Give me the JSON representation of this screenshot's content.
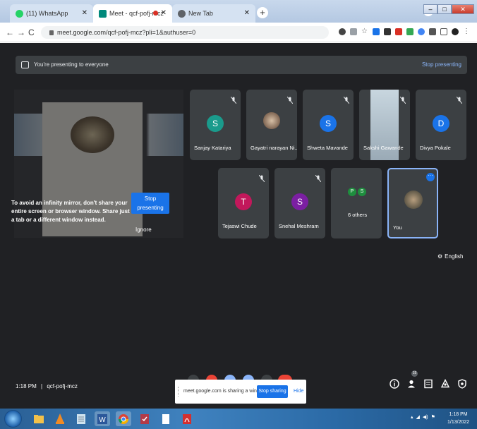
{
  "browser": {
    "tabs": [
      {
        "label": "(11) WhatsApp",
        "icon": "whatsapp-icon",
        "color": "#25d366"
      },
      {
        "label": "Meet - qcf-pofj-mcz",
        "icon": "meet-icon",
        "color": "#00897b"
      },
      {
        "label": "New Tab",
        "icon": "chrome-icon",
        "color": "#5f6368"
      }
    ],
    "url": "meet.google.com/qcf-pofj-mcz?pli=1&authuser=0"
  },
  "meet": {
    "banner": {
      "text": "You're presenting to everyone",
      "action": "Stop presenting"
    },
    "preview": {
      "message": "To avoid an infinity mirror, don't share your entire screen or browser window. Share just a tab or a different window instead.",
      "stop_button": "Stop presenting",
      "ignore_button": "Ignore"
    },
    "participants": [
      {
        "name": "Sanjay Katariya",
        "initial": "S",
        "color": "#1a9b8c",
        "muted": true
      },
      {
        "name": "Gayatri narayan Ni...",
        "initial": "",
        "color": "",
        "muted": true,
        "photo": true
      },
      {
        "name": "Shweta Mavande",
        "initial": "S",
        "color": "#1a73e8",
        "muted": true
      },
      {
        "name": "Sakshi Gawande",
        "initial": "",
        "color": "",
        "muted": true,
        "photo": true
      },
      {
        "name": "Divya Pokale",
        "initial": "D",
        "color": "#1a73e8",
        "muted": true
      },
      {
        "name": "Tejaswi Chude",
        "initial": "T",
        "color": "#c2185b",
        "muted": true
      },
      {
        "name": "Snehal Meshram",
        "initial": "S",
        "color": "#7b1fa2",
        "muted": true
      }
    ],
    "others": {
      "label": "6 others",
      "initials": [
        "P",
        "S"
      ],
      "colors": [
        "#1e8e3e",
        "#1e8e3e"
      ]
    },
    "you": {
      "label": "You"
    },
    "captions_language": "English",
    "time": "1:18 PM",
    "meeting_code": "qcf-pofj-mcz",
    "participant_count": "15",
    "share_bar": {
      "text": "meet.google.com is sharing a window.",
      "stop": "Stop sharing",
      "hide": "Hide"
    }
  },
  "taskbar": {
    "clock_time": "1:18 PM",
    "clock_date": "1/13/2022"
  }
}
